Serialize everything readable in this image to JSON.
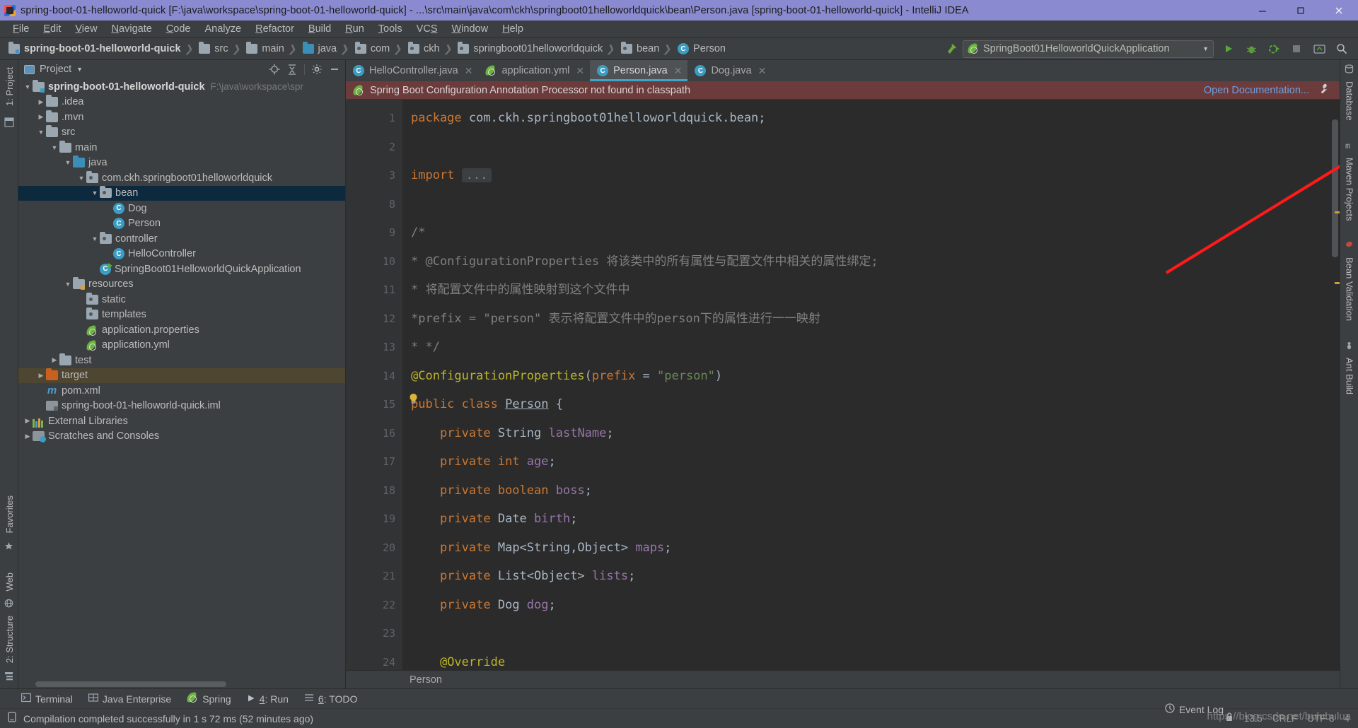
{
  "window": {
    "title": "spring-boot-01-helloworld-quick [F:\\java\\workspace\\spring-boot-01-helloworld-quick] - ...\\src\\main\\java\\com\\ckh\\springboot01helloworldquick\\bean\\Person.java [spring-boot-01-helloworld-quick] - IntelliJ IDEA",
    "minimize": "–",
    "maximize": "❐",
    "close": "✕"
  },
  "menu": [
    "File",
    "Edit",
    "View",
    "Navigate",
    "Code",
    "Analyze",
    "Refactor",
    "Build",
    "Run",
    "Tools",
    "VCS",
    "Window",
    "Help"
  ],
  "navbar": {
    "crumbs": [
      {
        "label": "spring-boot-01-helloworld-quick",
        "icon": "module-folder-icon"
      },
      {
        "label": "src",
        "icon": "source-folder-icon"
      },
      {
        "label": "main",
        "icon": "folder-icon"
      },
      {
        "label": "java",
        "icon": "java-source-folder-icon"
      },
      {
        "label": "com",
        "icon": "package-icon"
      },
      {
        "label": "ckh",
        "icon": "package-icon"
      },
      {
        "label": "springboot01helloworldquick",
        "icon": "package-icon"
      },
      {
        "label": "bean",
        "icon": "package-icon"
      },
      {
        "label": "Person",
        "icon": "class-icon"
      }
    ],
    "run_configuration": "SpringBoot01HelloworldQuickApplication",
    "buttons": [
      "run-button",
      "debug-button",
      "run-with-coverage-button",
      "stop-button",
      "update-button",
      "search-button"
    ]
  },
  "project_panel": {
    "title": "Project",
    "tree": [
      {
        "label": "spring-boot-01-helloworld-quick",
        "path": "F:\\java\\workspace\\spr",
        "indent": 0,
        "arrow": "▼",
        "icon": "module-folder-icon",
        "bold": true
      },
      {
        "label": ".idea",
        "indent": 1,
        "arrow": "▶",
        "icon": "folder-icon"
      },
      {
        "label": ".mvn",
        "indent": 1,
        "arrow": "▶",
        "icon": "folder-icon"
      },
      {
        "label": "src",
        "indent": 1,
        "arrow": "▼",
        "icon": "folder-icon"
      },
      {
        "label": "main",
        "indent": 2,
        "arrow": "▼",
        "icon": "folder-icon"
      },
      {
        "label": "java",
        "indent": 3,
        "arrow": "▼",
        "icon": "java-source-folder-icon"
      },
      {
        "label": "com.ckh.springboot01helloworldquick",
        "indent": 4,
        "arrow": "▼",
        "icon": "package-icon"
      },
      {
        "label": "bean",
        "indent": 5,
        "arrow": "▼",
        "icon": "package-icon",
        "selected": true
      },
      {
        "label": "Dog",
        "indent": 6,
        "arrow": "",
        "icon": "class-icon"
      },
      {
        "label": "Person",
        "indent": 6,
        "arrow": "",
        "icon": "class-icon"
      },
      {
        "label": "controller",
        "indent": 5,
        "arrow": "▼",
        "icon": "package-icon"
      },
      {
        "label": "HelloController",
        "indent": 6,
        "arrow": "",
        "icon": "class-icon"
      },
      {
        "label": "SpringBoot01HelloworldQuickApplication",
        "indent": 5,
        "arrow": "",
        "icon": "runnable-class-icon"
      },
      {
        "label": "resources",
        "indent": 3,
        "arrow": "▼",
        "icon": "resources-folder-icon"
      },
      {
        "label": "static",
        "indent": 4,
        "arrow": "",
        "icon": "package-icon"
      },
      {
        "label": "templates",
        "indent": 4,
        "arrow": "",
        "icon": "package-icon"
      },
      {
        "label": "application.properties",
        "indent": 4,
        "arrow": "",
        "icon": "spring-file-icon"
      },
      {
        "label": "application.yml",
        "indent": 4,
        "arrow": "",
        "icon": "spring-file-icon"
      },
      {
        "label": "test",
        "indent": 2,
        "arrow": "▶",
        "icon": "folder-icon"
      },
      {
        "label": "target",
        "indent": 1,
        "arrow": "▶",
        "icon": "excluded-folder-icon",
        "highlighted": true
      },
      {
        "label": "pom.xml",
        "indent": 1,
        "arrow": "",
        "icon": "maven-icon"
      },
      {
        "label": "spring-boot-01-helloworld-quick.iml",
        "indent": 1,
        "arrow": "",
        "icon": "iml-icon"
      },
      {
        "label": "External Libraries",
        "indent": 0,
        "arrow": "▶",
        "icon": "library-icon"
      },
      {
        "label": "Scratches and Consoles",
        "indent": 0,
        "arrow": "▶",
        "icon": "scratch-icon"
      }
    ]
  },
  "editor": {
    "tabs": [
      {
        "label": "HelloController.java",
        "icon": "class-icon",
        "active": false
      },
      {
        "label": "application.yml",
        "icon": "spring-file-icon",
        "active": false
      },
      {
        "label": "Person.java",
        "icon": "class-icon",
        "active": true
      },
      {
        "label": "Dog.java",
        "icon": "class-icon",
        "active": false
      }
    ],
    "close_glyph": "✕",
    "banner": {
      "icon": "spring-leaf-icon",
      "message": "Spring Boot Configuration Annotation Processor not found in classpath",
      "link": "Open Documentation...",
      "settings_icon": "wrench-icon"
    },
    "line_numbers": [
      "1",
      "2",
      "3",
      "8",
      "9",
      "10",
      "11",
      "12",
      "13",
      "14",
      "15",
      "16",
      "17",
      "18",
      "19",
      "20",
      "21",
      "22",
      "23",
      "24"
    ],
    "lines": [
      {
        "n": "1",
        "html": "<span class='kw'>package</span> com.ckh.springboot01helloworldquick.bean;"
      },
      {
        "n": "2",
        "html": ""
      },
      {
        "n": "3",
        "html": "<span class='kw'>import</span> <span class='elip'>...</span>",
        "fold": true
      },
      {
        "n": "8",
        "html": ""
      },
      {
        "n": "9",
        "html": "<span class='cmt'>/*</span>"
      },
      {
        "n": "10",
        "html": "<span class='cmt'>* @ConfigurationProperties 将该类中的所有属性与配置文件中相关的属性绑定;</span>"
      },
      {
        "n": "11",
        "html": "<span class='cmt'>* 将配置文件中的属性映射到这个文件中</span>"
      },
      {
        "n": "12",
        "html": "<span class='cmt'>*prefix = \"person\" 表示将配置文件中的person下的属性进行一一映射</span>"
      },
      {
        "n": "13",
        "html": "<span class='cmt'>* */</span>"
      },
      {
        "n": "14",
        "html": "<span class='ann'>@ConfigurationProperties</span>(<span class='kw'>prefix</span> = <span class='str'>\"person\"</span>)"
      },
      {
        "n": "15",
        "html": "<span class='kw'>public class</span> <span class='cls-name'>Person</span> {"
      },
      {
        "n": "16",
        "html": "    <span class='kw'>private</span> String <span class='fld'>lastName</span>;"
      },
      {
        "n": "17",
        "html": "    <span class='kw'>private int</span> <span class='fld'>age</span>;"
      },
      {
        "n": "18",
        "html": "    <span class='kw'>private boolean</span> <span class='fld'>boss</span>;"
      },
      {
        "n": "19",
        "html": "    <span class='kw'>private</span> Date <span class='fld'>birth</span>;"
      },
      {
        "n": "20",
        "html": "    <span class='kw'>private</span> Map&lt;String,Object&gt; <span class='fld'>maps</span>;"
      },
      {
        "n": "21",
        "html": "    <span class='kw'>private</span> List&lt;Object&gt; <span class='fld'>lists</span>;"
      },
      {
        "n": "22",
        "html": "    <span class='kw'>private</span> Dog <span class='fld'>dog</span>;"
      },
      {
        "n": "23",
        "html": ""
      },
      {
        "n": "24",
        "html": "    <span class='ann'>@Override</span>"
      }
    ],
    "breadcrumb": "Person"
  },
  "left_rail": {
    "top": [
      "1: Project"
    ],
    "middle": [
      "Favorites",
      "Web"
    ],
    "bottom": [
      "2: Structure"
    ]
  },
  "right_rail": [
    "Database",
    "Maven Projects",
    "Bean Validation",
    "Ant Build"
  ],
  "bottom_tools": [
    {
      "label": "Terminal",
      "icon": "terminal-icon"
    },
    {
      "label": "Java Enterprise",
      "icon": "java-ee-icon"
    },
    {
      "label": "Spring",
      "icon": "spring-leaf-icon"
    },
    {
      "label": "4: Run",
      "icon": "run-icon"
    },
    {
      "label": "6: TODO",
      "icon": "todo-icon"
    }
  ],
  "statusbar": {
    "message": "Compilation completed successfully in 1 s 72 ms (52 minutes ago)",
    "event_log": "Event Log",
    "watermark": "https://blog.csdn.net/bulubulua",
    "position": "13:5",
    "line_sep": "CRLF",
    "encoding": "UTF-8",
    "indent": "4"
  }
}
